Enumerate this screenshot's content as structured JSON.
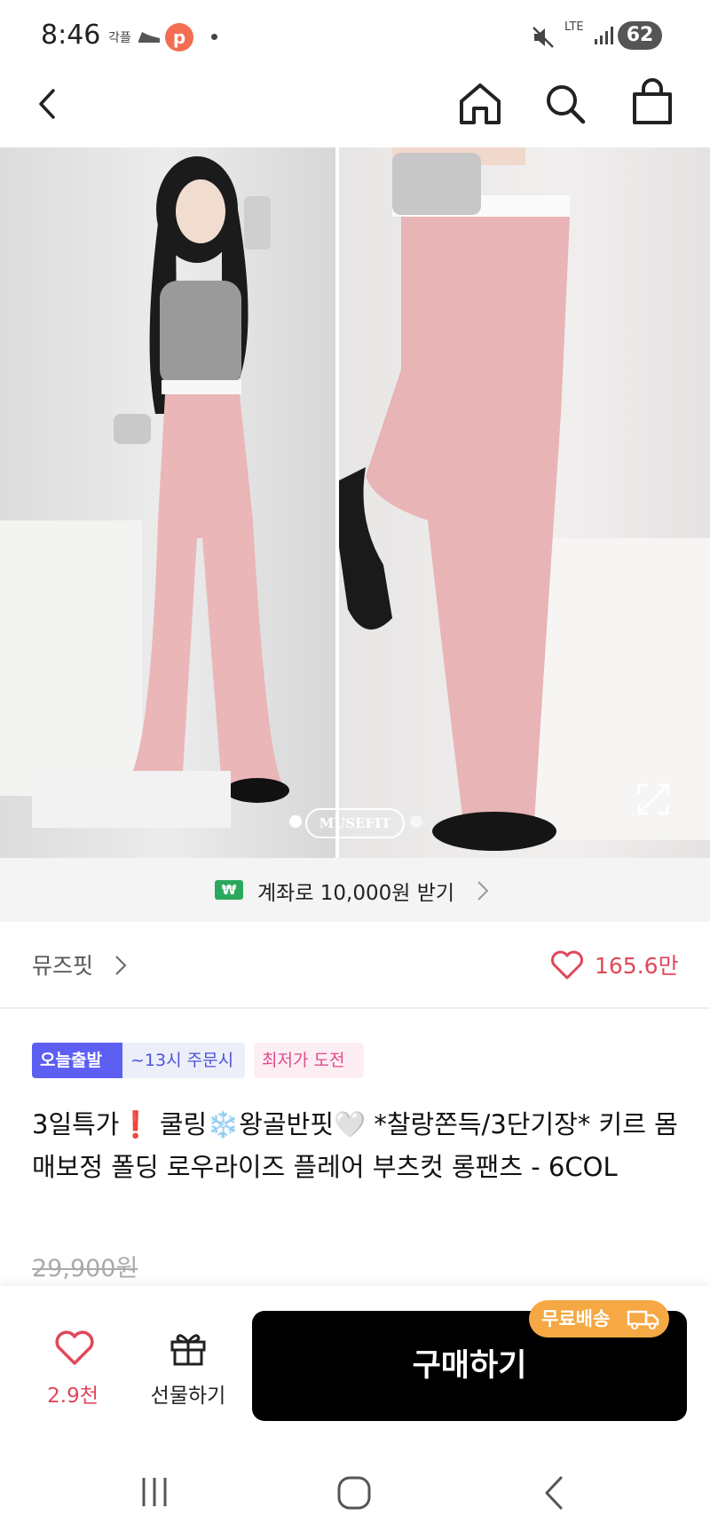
{
  "status_bar": {
    "time": "8:46",
    "left_text": "각플",
    "app_icon_letter": "p",
    "network": "LTE",
    "battery": "62"
  },
  "nav": {
    "back_icon": "chevron-left-icon",
    "home_icon": "home-icon",
    "search_icon": "search-icon",
    "bag_icon": "shopping-bag-icon"
  },
  "image": {
    "brand_watermark": "MUSEFIT",
    "pager_current": 1,
    "pager_total": 2
  },
  "cashback": {
    "icon_text": "₩",
    "text": "계좌로 10,000원 받기"
  },
  "shop": {
    "name": "뮤즈핏",
    "likes": "165.6만"
  },
  "tags": {
    "today": "오늘출발",
    "cutoff": "~13시 주문시",
    "lowest": "최저가 도전"
  },
  "product": {
    "title": "3일특가❗️ 쿨링❄️왕골반핏🤍 *찰랑쫀득/3단기장* 키르 몸매보정 폴딩 로우라이즈 플레어 부츠컷 롱팬츠 - 6COL",
    "original_price": "29,900원"
  },
  "bottom_bar": {
    "wish_count": "2.9천",
    "gift_label": "선물하기",
    "buy_label": "구매하기",
    "free_shipping": "무료배송"
  },
  "colors": {
    "accent_pink": "#e0485a",
    "today_blue": "#5c5ff2",
    "shipping_orange": "#f5a843",
    "cashback_green": "#2aa95c"
  }
}
